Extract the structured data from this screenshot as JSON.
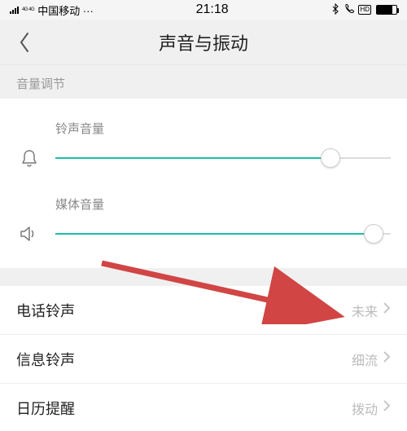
{
  "statusbar": {
    "net_label": "4G 4G",
    "carrier": "中国移动 ···",
    "time": "21:18",
    "hd": "HD"
  },
  "nav": {
    "title": "声音与振动"
  },
  "section": {
    "volume_label": "音量调节"
  },
  "volumes": {
    "ringtone_label": "铃声音量",
    "media_label": "媒体音量"
  },
  "rows": {
    "phone_ringtone": {
      "label": "电话铃声",
      "value": "未来"
    },
    "message_ringtone": {
      "label": "信息铃声",
      "value": "细流"
    },
    "calendar_reminder": {
      "label": "日历提醒",
      "value": "拨动"
    }
  }
}
